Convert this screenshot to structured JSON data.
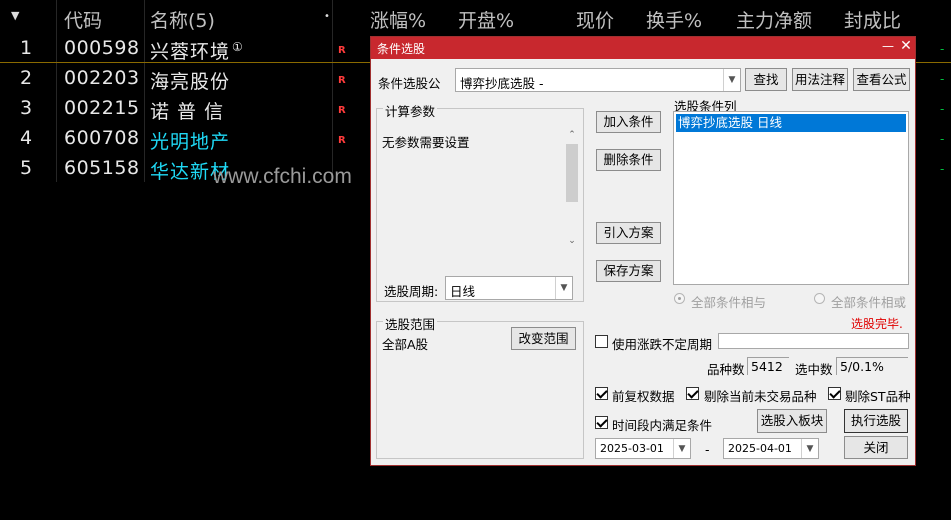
{
  "table": {
    "headers": [
      "代码",
      "名称(5)",
      "涨幅%",
      "开盘%",
      "现价",
      "换手%",
      "主力净额",
      "封成比"
    ],
    "sort_icon": "▼",
    "rows": [
      {
        "idx": "1",
        "code": "000598",
        "name": "兴蓉环境",
        "badge": "①",
        "flag": "R",
        "name_color": "#e8e8e8"
      },
      {
        "idx": "2",
        "code": "002203",
        "name": "海亮股份",
        "badge": "",
        "flag": "R",
        "name_color": "#e8e8e8"
      },
      {
        "idx": "3",
        "code": "002215",
        "name": "诺 普 信",
        "badge": "",
        "flag": "R",
        "name_color": "#e8e8e8"
      },
      {
        "idx": "4",
        "code": "600708",
        "name": "光明地产",
        "badge": "",
        "flag": "R",
        "name_color": "#1fd9f5"
      },
      {
        "idx": "5",
        "code": "605158",
        "name": "华达新材",
        "badge": "",
        "flag": "",
        "name_color": "#1fd9f5"
      }
    ],
    "dash": "-"
  },
  "watermark": "www.cfchi.com",
  "dialog": {
    "title": "条件选股",
    "win_min": "—",
    "win_close": "✕",
    "formula_label": "条件选股公",
    "formula_value": "博弈抄底选股  -",
    "btn_search": "查找",
    "btn_usage": "用法注释",
    "btn_view": "查看公式",
    "params_title": "计算参数",
    "params_text": "无参数需要设置",
    "period_label": "选股周期:",
    "period_value": "日线",
    "btn_add": "加入条件",
    "btn_delete": "删除条件",
    "btn_import": "引入方案",
    "btn_save": "保存方案",
    "conditions_title": "选股条件列",
    "condition_item": "博弈抄底选股  日线",
    "radio_and": "全部条件相与",
    "radio_or": "全部条件相或",
    "status": "选股完毕.",
    "range_title": "选股范围",
    "range_value": "全部A股",
    "btn_change_range": "改变范围",
    "chk_irregular": "使用涨跌不定周期",
    "count_label": "品种数",
    "count_value": "5412",
    "selected_label": "选中数",
    "selected_value": "5/0.1%",
    "chk_adjust": "前复权数据",
    "chk_remove_untraded": "剔除当前未交易品种",
    "chk_remove_st": "剔除ST品种",
    "chk_period": "时间段内满足条件",
    "btn_to_block": "选股入板块",
    "btn_execute": "执行选股",
    "date_from": "2025-03-01",
    "date_sep": "-",
    "date_to": "2025-04-01",
    "btn_close": "关闭"
  }
}
